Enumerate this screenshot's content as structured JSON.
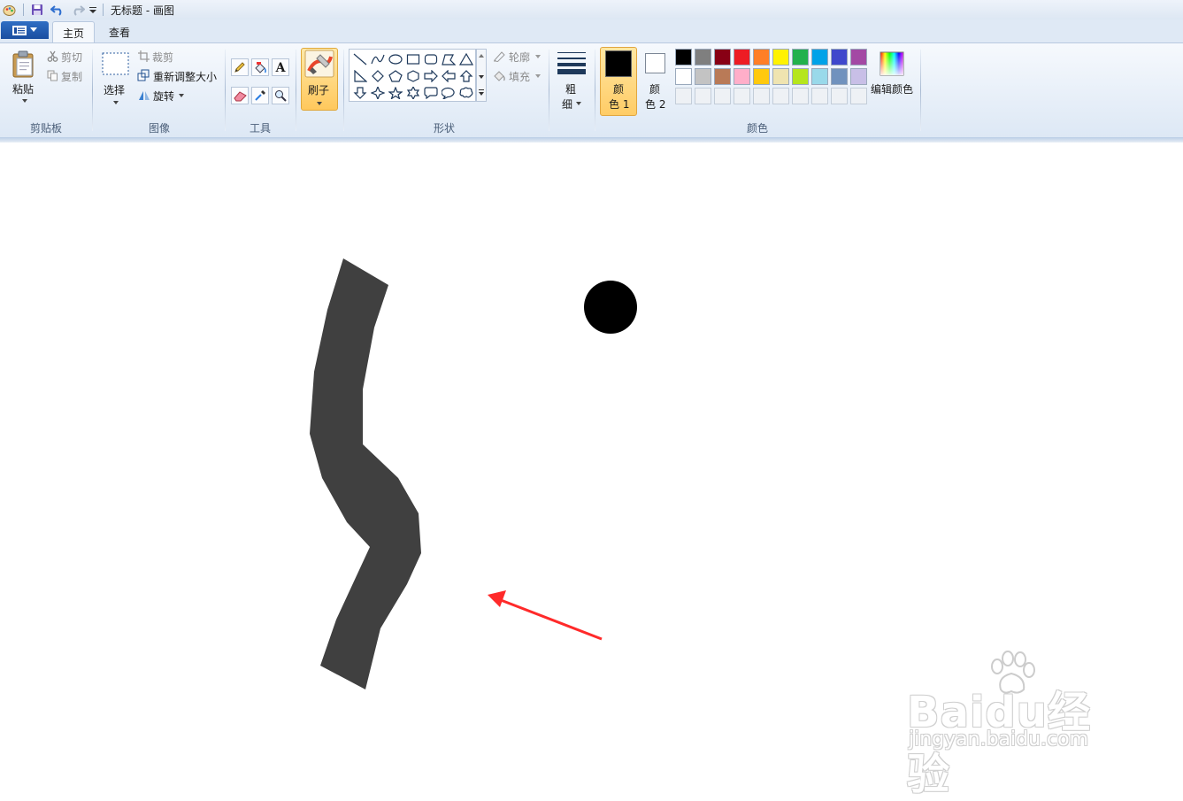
{
  "window": {
    "title": "无标题 - 画图"
  },
  "tabs": [
    {
      "label": "主页",
      "active": true
    },
    {
      "label": "查看",
      "active": false
    }
  ],
  "clipboard": {
    "paste": "粘贴",
    "cut": "剪切",
    "copy": "复制",
    "group": "剪贴板"
  },
  "image": {
    "select": "选择",
    "crop": "裁剪",
    "resize": "重新调整大小",
    "rotate": "旋转",
    "group": "图像"
  },
  "tools": {
    "group": "工具",
    "icons": [
      "pencil-icon",
      "fill-bucket-icon",
      "text-icon",
      "eraser-icon",
      "color-picker-icon",
      "magnifier-icon"
    ]
  },
  "brushes": {
    "label": "刷子"
  },
  "shapes": {
    "group": "形状",
    "outline": "轮廓",
    "fill": "填充"
  },
  "size": {
    "label_top": "粗",
    "label_bottom": "细"
  },
  "colors": {
    "group": "颜色",
    "color1": {
      "top": "颜",
      "bottom": "色 1",
      "value": "#000000"
    },
    "color2": {
      "top": "颜",
      "bottom": "色 2",
      "value": "#ffffff"
    },
    "edit": "编辑颜色",
    "palette_row1": [
      "#000000",
      "#7f7f7f",
      "#880015",
      "#ed1c24",
      "#ff7f27",
      "#fff200",
      "#22b14c",
      "#00a2e8",
      "#3f48cc",
      "#a349a4"
    ],
    "palette_row2": [
      "#ffffff",
      "#c3c3c3",
      "#b97a57",
      "#ffaec9",
      "#ffc90e",
      "#efe4b0",
      "#b5e61d",
      "#99d9ea",
      "#7092be",
      "#c8bfe7"
    ]
  },
  "canvas_art": {
    "stroke_color": "#404040",
    "dot_color": "#000000",
    "arrow_color": "#ff2a2a"
  },
  "watermark": {
    "brand": "Baidu经验",
    "sub": "jingyan.baidu.com"
  }
}
